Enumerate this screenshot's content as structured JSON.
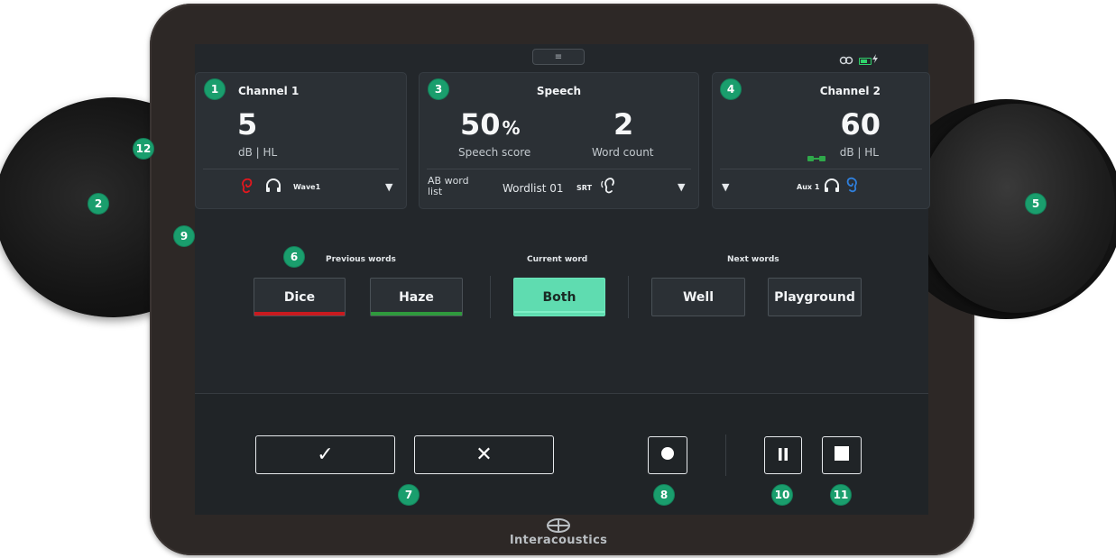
{
  "colors": {
    "accent_green": "#5fdcb0",
    "callout_green": "#1a9e6d",
    "left_ear_red": "#e3171e",
    "right_ear_blue": "#2f7fdc",
    "score_right_green": "#2fa84a"
  },
  "status": {
    "menu_icon": "menu-icon",
    "link_icon": "link-icon",
    "battery_level": 0.6,
    "bolt_icon": "charging-icon"
  },
  "channel1": {
    "title": "Channel 1",
    "level": "5",
    "unit": "dB | HL",
    "ear": "left",
    "transducer": "headphones",
    "stimulus": "Wave1"
  },
  "speech": {
    "title": "Speech",
    "score": "50",
    "score_unit": "%",
    "score_label": "Speech score",
    "word_count": "2",
    "word_count_label": "Word count",
    "list_type": "AB word list",
    "wordlist": "Wordlist 01",
    "test_type": "SRT"
  },
  "channel2": {
    "title": "Channel 2",
    "level": "60",
    "unit": "dB | HL",
    "input": "Aux 1",
    "ear": "right"
  },
  "words": {
    "previous_label": "Previous words",
    "current_label": "Current word",
    "next_label": "Next words",
    "previous": [
      {
        "text": "Dice",
        "result": "incorrect"
      },
      {
        "text": "Haze",
        "result": "correct"
      }
    ],
    "current": "Both",
    "next": [
      "Well",
      "Playground"
    ]
  },
  "controls": {
    "correct_symbol": "✓",
    "incorrect_symbol": "✕"
  },
  "callouts": [
    "1",
    "2",
    "3",
    "4",
    "5",
    "6",
    "7",
    "8",
    "9",
    "10",
    "11",
    "12"
  ],
  "brand": "Interacoustics"
}
